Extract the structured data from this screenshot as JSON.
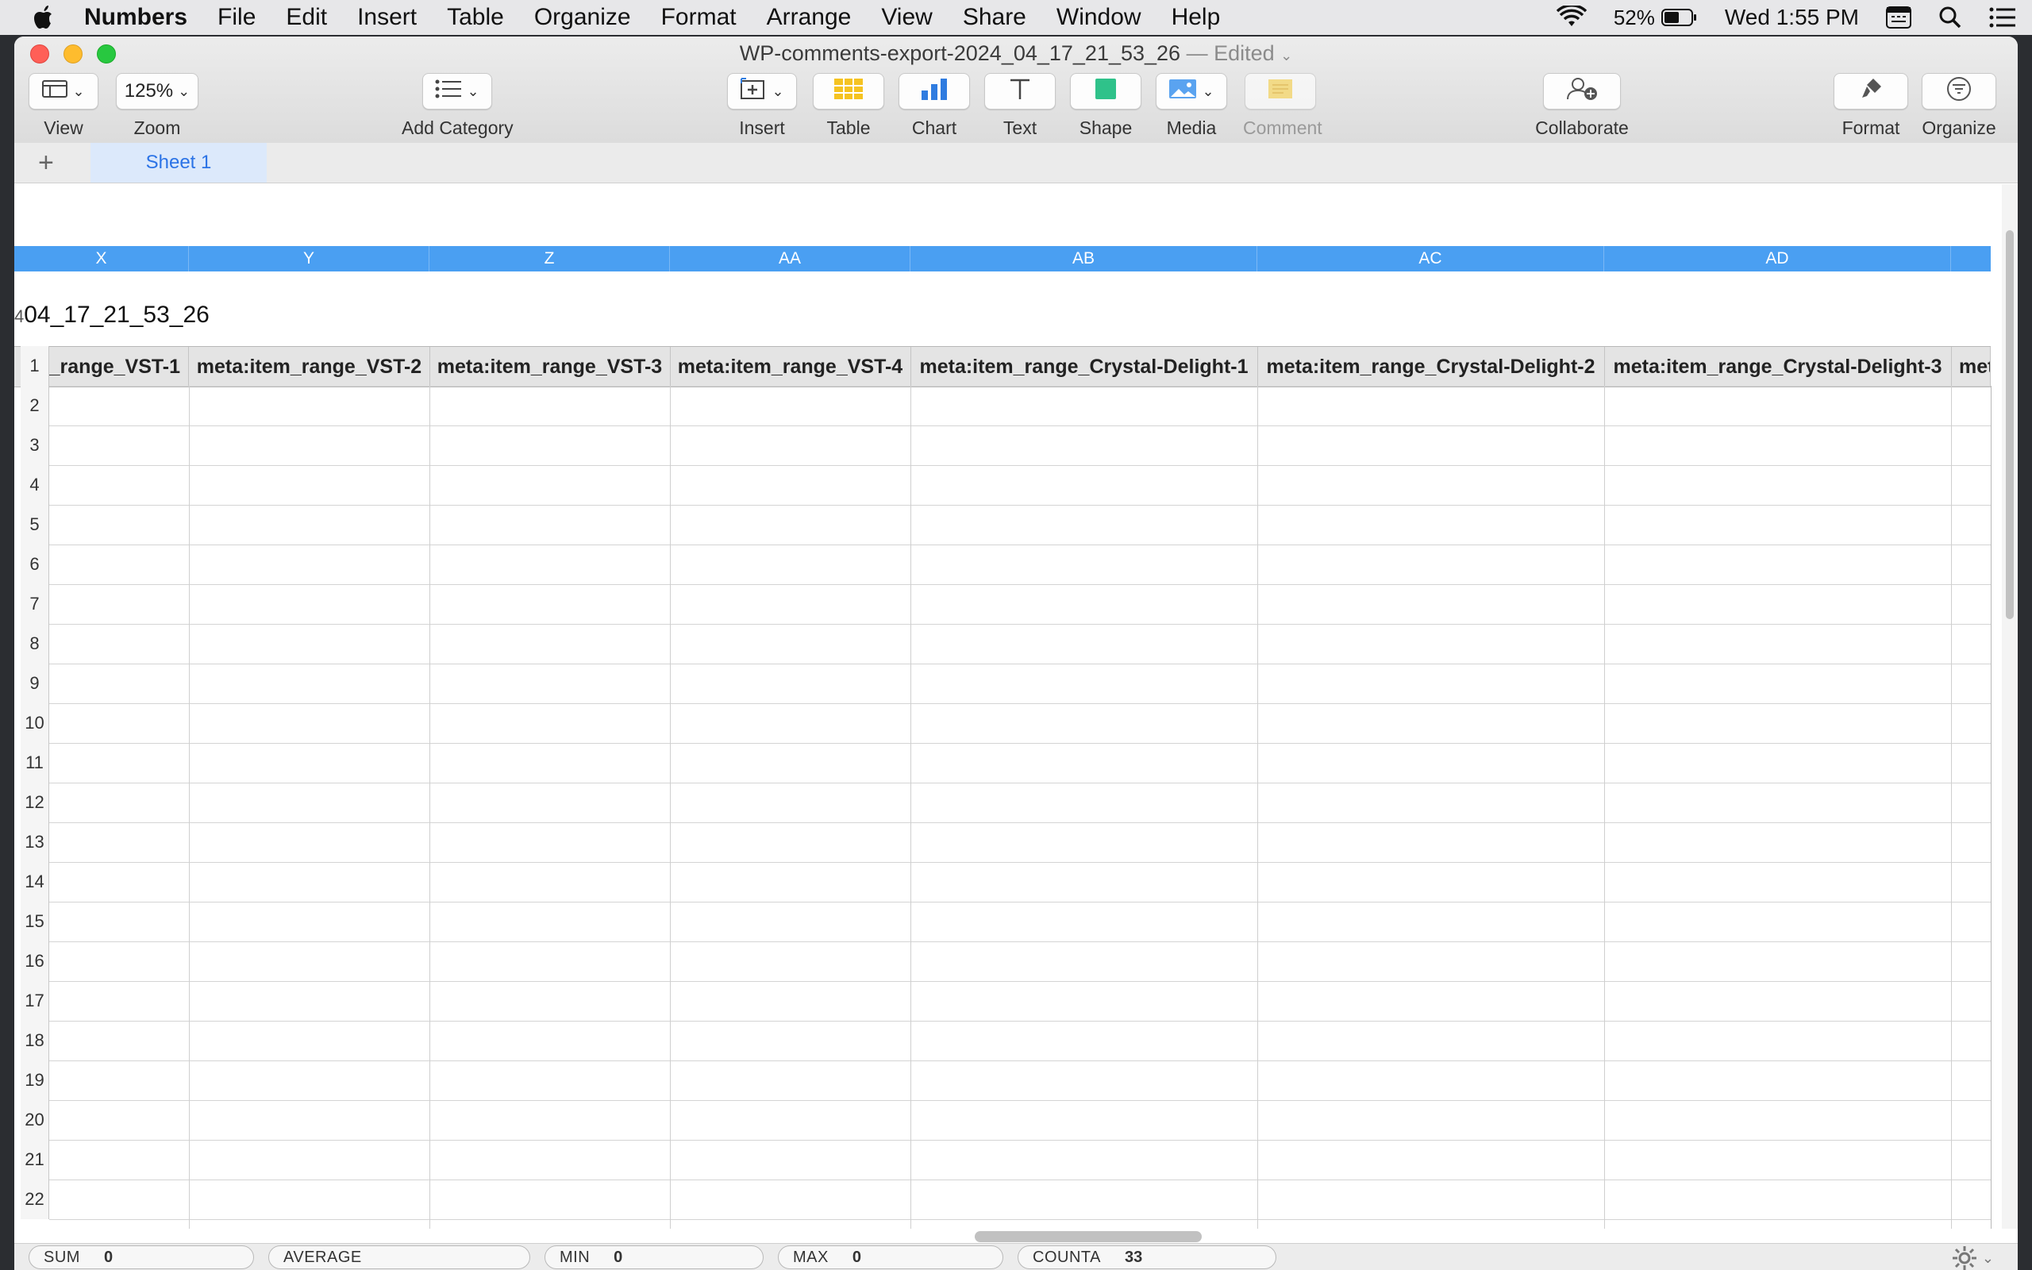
{
  "menubar": {
    "app_name": "Numbers",
    "items": [
      "File",
      "Edit",
      "Insert",
      "Table",
      "Organize",
      "Format",
      "Arrange",
      "View",
      "Share",
      "Window",
      "Help"
    ],
    "battery": "52%",
    "clock": "Wed 1:55 PM",
    "icons": [
      "apple-icon",
      "wifi-icon",
      "battery-icon",
      "keyboard-icon",
      "search-icon",
      "list-icon"
    ]
  },
  "window": {
    "title": "WP-comments-export-2024_04_17_21_53_26",
    "edited": "— Edited"
  },
  "toolbar": {
    "view": "View",
    "zoom_value": "125%",
    "zoom": "Zoom",
    "add_category": "Add Category",
    "insert": "Insert",
    "table": "Table",
    "chart": "Chart",
    "text": "Text",
    "shape": "Shape",
    "media": "Media",
    "comment": "Comment",
    "collaborate": "Collaborate",
    "format": "Format",
    "organize": "Organize"
  },
  "sheets": {
    "add": "+",
    "tabs": [
      "Sheet 1"
    ]
  },
  "grid": {
    "table_title_fragment": "04_17_21_53_26",
    "table_title_cut": "4",
    "column_letters": [
      "X",
      "Y",
      "Z",
      "AA",
      "AB",
      "AC",
      "AD"
    ],
    "header_cells": [
      "_range_VST-1",
      "meta:item_range_VST-2",
      "meta:item_range_VST-3",
      "meta:item_range_VST-4",
      "meta:item_range_Crystal-Delight-1",
      "meta:item_range_Crystal-Delight-2",
      "meta:item_range_Crystal-Delight-3",
      "met"
    ],
    "row_numbers": [
      "1",
      "2",
      "3",
      "4",
      "5",
      "6",
      "7",
      "8",
      "9",
      "10",
      "11",
      "12",
      "13",
      "14",
      "15",
      "16",
      "17",
      "18",
      "19",
      "20",
      "21",
      "22"
    ]
  },
  "statusbar": {
    "sum_label": "SUM",
    "sum_value": "0",
    "average_label": "AVERAGE",
    "min_label": "MIN",
    "min_value": "0",
    "max_label": "MAX",
    "max_value": "0",
    "counta_label": "COUNTA",
    "counta_value": "33"
  },
  "colors": {
    "column_header_blue": "#4a9ff2",
    "sheet_tab_bg": "#dce9fb",
    "sheet_tab_text": "#2b73e6",
    "table_tool": "#f5c321",
    "chart_tool": "#2f7ce0",
    "shape_tool": "#2fc28a"
  }
}
